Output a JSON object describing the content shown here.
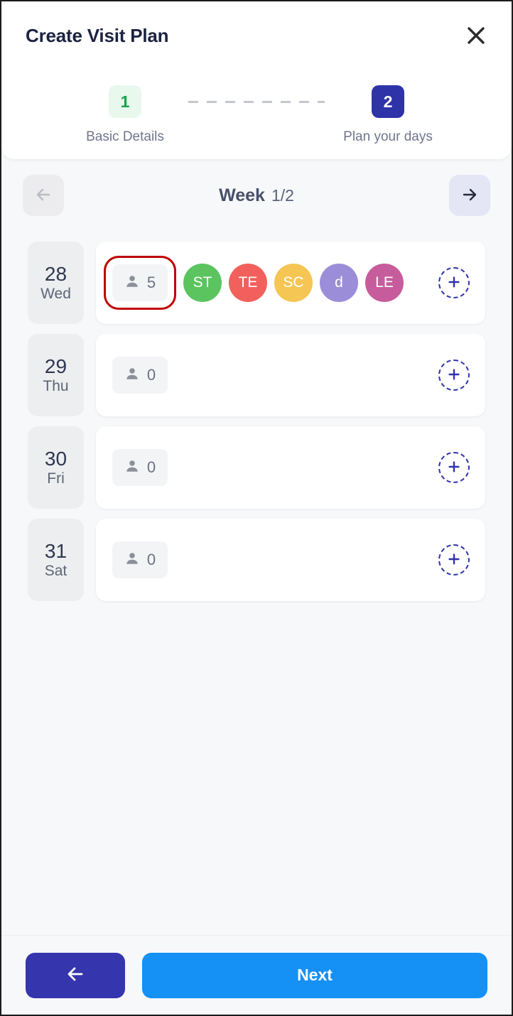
{
  "header": {
    "title": "Create Visit Plan",
    "close_icon": "close-icon"
  },
  "stepper": {
    "steps": [
      {
        "number": "1",
        "label": "Basic Details",
        "state": "done"
      },
      {
        "number": "2",
        "label": "Plan your days",
        "state": "active"
      }
    ]
  },
  "week_nav": {
    "prev_icon": "arrow-left-icon",
    "next_icon": "arrow-right-icon",
    "label": "Week",
    "count": "1/2"
  },
  "days": [
    {
      "date": "28",
      "dow": "Wed",
      "count": "5",
      "count_highlighted": true,
      "avatars": [
        {
          "initials": "ST",
          "color": "#5bc45f"
        },
        {
          "initials": "TE",
          "color": "#f1605c"
        },
        {
          "initials": "SC",
          "color": "#f5c654"
        },
        {
          "initials": "d",
          "color": "#9b8dd8"
        },
        {
          "initials": "LE",
          "color": "#c75c9c"
        }
      ],
      "add_icon": "plus-icon"
    },
    {
      "date": "29",
      "dow": "Thu",
      "count": "0",
      "count_highlighted": false,
      "avatars": [],
      "add_icon": "plus-icon"
    },
    {
      "date": "30",
      "dow": "Fri",
      "count": "0",
      "count_highlighted": false,
      "avatars": [],
      "add_icon": "plus-icon"
    },
    {
      "date": "31",
      "dow": "Sat",
      "count": "0",
      "count_highlighted": false,
      "avatars": [],
      "add_icon": "plus-icon"
    }
  ],
  "footer": {
    "back_icon": "arrow-left-icon",
    "next_label": "Next"
  },
  "colors": {
    "primary_indigo": "#2f33a8",
    "next_blue": "#1590f5",
    "back_indigo": "#3535ad",
    "step_done_green": "#16a34a",
    "annotation_red": "#c00000",
    "page_bg": "#f7f8fa"
  }
}
